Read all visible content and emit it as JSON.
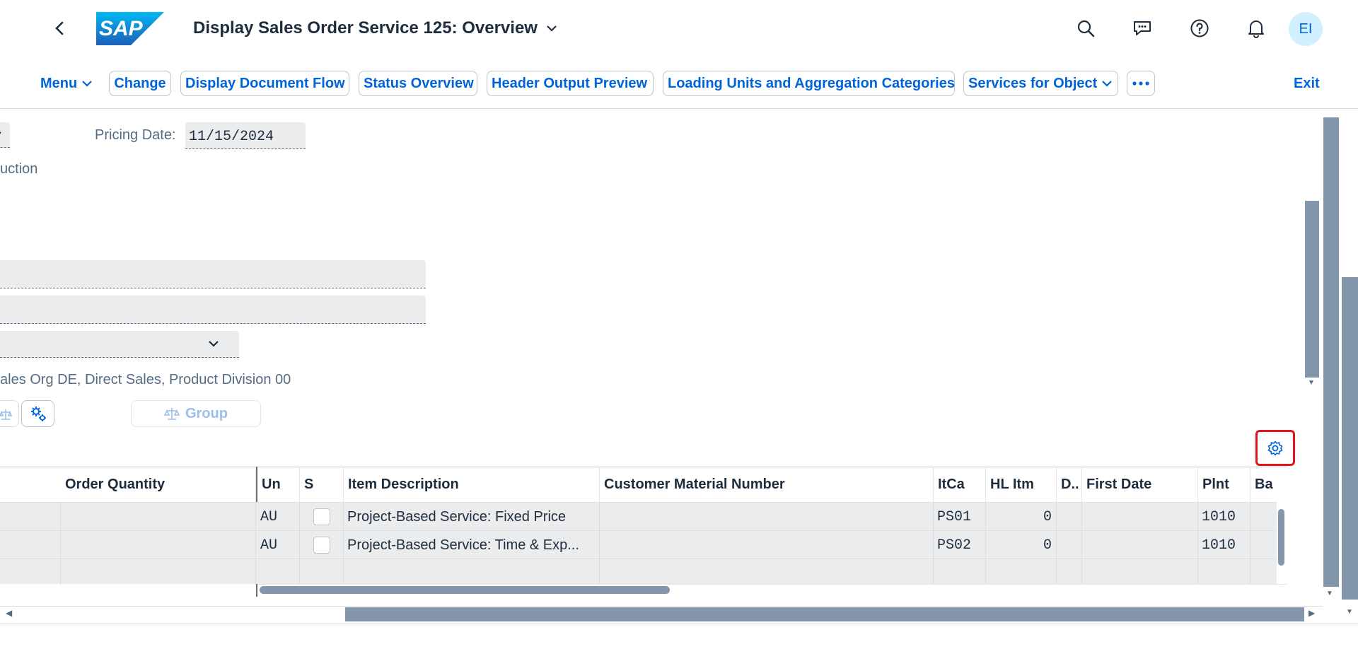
{
  "shell": {
    "logo_text": "SAP",
    "title": "Display Sales Order Service 125: Overview",
    "avatar_initials": "EI",
    "brand_color": "#0a6ed1"
  },
  "toolbar": {
    "menu_label": "Menu",
    "buttons": [
      "Change",
      "Display Document Flow",
      "Status Overview",
      "Header Output Preview",
      "Loading Units and Aggregation Categories",
      "Services for Object"
    ],
    "exit_label": "Exit"
  },
  "form": {
    "pricing_date_label": "Pricing Date:",
    "pricing_date_value": "11/15/2024",
    "partial_text_1": "uction",
    "partial_text_2": "ales Org DE, Direct Sales, Product Division 00",
    "group_button": "Group"
  },
  "table": {
    "columns": [
      "Order Quantity",
      "Un",
      "S",
      "Item Description",
      "Customer Material Number",
      "ItCa",
      "HL Itm",
      "D..",
      "First Date",
      "Plnt",
      "Ba"
    ],
    "rows": [
      {
        "unit": "AU",
        "description": "Project-Based Service: Fixed Price",
        "itca": "PS01",
        "hl_itm": "0",
        "plant": "1010"
      },
      {
        "unit": "AU",
        "description": "Project-Based Service: Time & Exp...",
        "itca": "PS02",
        "hl_itm": "0",
        "plant": "1010"
      }
    ]
  }
}
